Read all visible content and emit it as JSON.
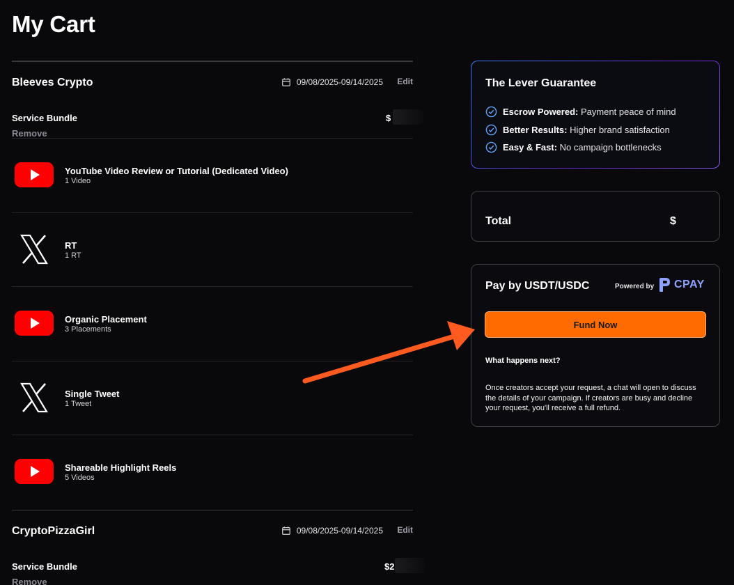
{
  "page": {
    "title": "My Cart"
  },
  "vendors": [
    {
      "name": "Bleeves Crypto",
      "dates": "09/08/2025-09/14/2025",
      "edit_label": "Edit",
      "bundle_label": "Service Bundle",
      "price_visible": "$",
      "remove_label": "Remove",
      "items": [
        {
          "platform": "youtube-icon",
          "title": "YouTube Video Review or Tutorial (Dedicated Video)",
          "sub": "1 Video"
        },
        {
          "platform": "x-icon",
          "title": "RT",
          "sub": "1 RT"
        },
        {
          "platform": "youtube-icon",
          "title": "Organic Placement",
          "sub": "3 Placements"
        },
        {
          "platform": "x-icon",
          "title": "Single Tweet",
          "sub": "1 Tweet"
        },
        {
          "platform": "youtube-icon",
          "title": "Shareable Highlight Reels",
          "sub": "5 Videos"
        }
      ]
    },
    {
      "name": "CryptoPizzaGirl",
      "dates": "09/08/2025-09/14/2025",
      "edit_label": "Edit",
      "bundle_label": "Service Bundle",
      "price_visible": "$2",
      "remove_label": "Remove"
    }
  ],
  "guarantee": {
    "title": "The Lever Guarantee",
    "items": [
      {
        "bold": "Escrow Powered:",
        "text": " Payment peace of mind"
      },
      {
        "bold": "Better Results:",
        "text": " Higher brand satisfaction"
      },
      {
        "bold": "Easy & Fast:",
        "text": " No campaign bottlenecks"
      }
    ]
  },
  "total": {
    "label": "Total",
    "value": "$"
  },
  "payment": {
    "title": "Pay by USDT/USDC",
    "powered_by": "Powered by",
    "provider": "CPAY",
    "fund_button": "Fund Now",
    "next_title": "What happens next?",
    "next_body": "Once creators accept your request, a chat will open to discuss the details of your campaign. If creators are busy and decline your request, you'll receive a full refund."
  },
  "colors": {
    "background": "#09090b",
    "accent_orange": "#ff6b00",
    "youtube_red": "#ff0000",
    "cpay_blue": "#8ea2ff",
    "check_blue": "#60a5fa"
  }
}
